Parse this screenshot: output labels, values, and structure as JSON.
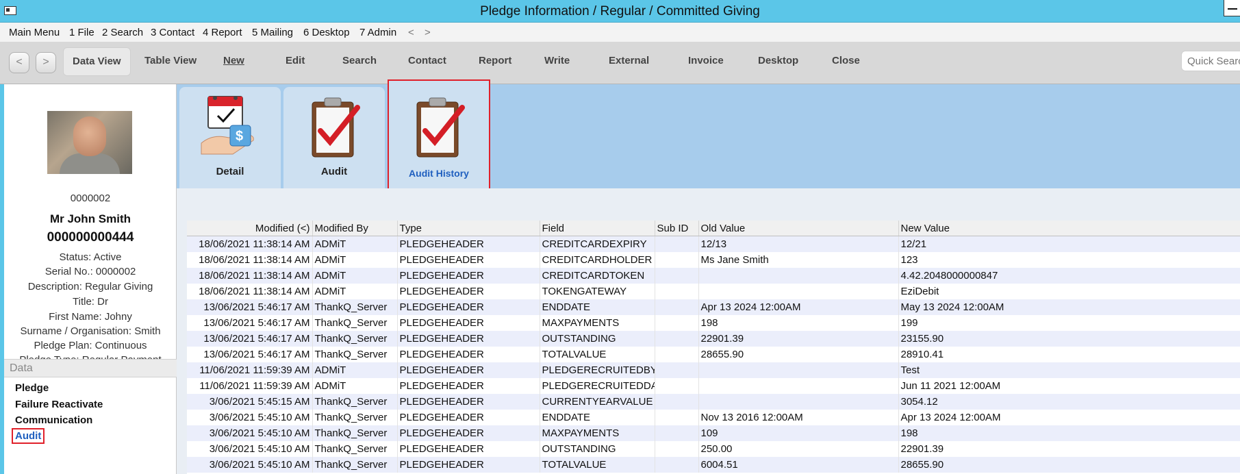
{
  "window": {
    "title": "Pledge Information / Regular / Committed Giving"
  },
  "menu": {
    "items": [
      "Main Menu",
      "1 File",
      "2 Search",
      "3 Contact",
      "4 Report",
      "5 Mailing",
      "6 Desktop",
      "7 Admin"
    ],
    "back": "<",
    "forward": ">"
  },
  "toolbar": {
    "back_label": "<",
    "forward_label": ">",
    "items": [
      "Data View",
      "Table View",
      "New",
      "Edit",
      "Search",
      "Contact",
      "Report",
      "Write",
      "External",
      "Invoice",
      "Desktop",
      "Close"
    ],
    "quick_search_placeholder": "Quick Search"
  },
  "profile": {
    "id": "0000002",
    "name": "Mr John Smith",
    "pledge_number": "000000000444",
    "status": "Status: Active",
    "serial": "Serial No.: 0000002",
    "description": "Description: Regular Giving",
    "title": "Title: Dr",
    "first_name": "First Name: Johny",
    "surname": "Surname / Organisation: Smith",
    "pledge_plan": "Pledge Plan: Continuous",
    "pledge_type": "Pledge Type: Regular Payment"
  },
  "data_section": {
    "header": "Data",
    "items": [
      "Pledge",
      "Failure Reactivate",
      "Communication",
      "Audit"
    ],
    "selected": "Audit"
  },
  "tabs": [
    {
      "label": "Detail",
      "icon": "calendar-money-icon"
    },
    {
      "label": "Audit",
      "icon": "clipboard-check-icon"
    },
    {
      "label": "Audit History",
      "icon": "clipboard-check-icon"
    }
  ],
  "grid": {
    "columns": [
      "Modified (<)",
      "Modified By",
      "Type",
      "Field",
      "Sub ID",
      "Old Value",
      "New Value"
    ],
    "rows": [
      [
        "18/06/2021 11:38:14 AM",
        "ADMiT",
        "PLEDGEHEADER",
        "CREDITCARDEXPIRY",
        "",
        "12/13",
        "12/21"
      ],
      [
        "18/06/2021 11:38:14 AM",
        "ADMiT",
        "PLEDGEHEADER",
        "CREDITCARDHOLDER",
        "",
        "Ms Jane Smith",
        "123"
      ],
      [
        "18/06/2021 11:38:14 AM",
        "ADMiT",
        "PLEDGEHEADER",
        "CREDITCARDTOKEN",
        "",
        "",
        "4.42.2048000000847"
      ],
      [
        "18/06/2021 11:38:14 AM",
        "ADMiT",
        "PLEDGEHEADER",
        "TOKENGATEWAY",
        "",
        "",
        "EziDebit"
      ],
      [
        "13/06/2021 5:46:17 AM",
        "ThankQ_Server",
        "PLEDGEHEADER",
        "ENDDATE",
        "",
        "Apr 13 2024 12:00AM",
        "May 13 2024 12:00AM"
      ],
      [
        "13/06/2021 5:46:17 AM",
        "ThankQ_Server",
        "PLEDGEHEADER",
        "MAXPAYMENTS",
        "",
        "198",
        "199"
      ],
      [
        "13/06/2021 5:46:17 AM",
        "ThankQ_Server",
        "PLEDGEHEADER",
        "OUTSTANDING",
        "",
        "22901.39",
        "23155.90"
      ],
      [
        "13/06/2021 5:46:17 AM",
        "ThankQ_Server",
        "PLEDGEHEADER",
        "TOTALVALUE",
        "",
        "28655.90",
        "28910.41"
      ],
      [
        "11/06/2021 11:59:39 AM",
        "ADMiT",
        "PLEDGEHEADER",
        "PLEDGERECRUITEDBY",
        "",
        "",
        "Test"
      ],
      [
        "11/06/2021 11:59:39 AM",
        "ADMiT",
        "PLEDGEHEADER",
        "PLEDGERECRUITEDDATE",
        "",
        "",
        "Jun 11 2021 12:00AM"
      ],
      [
        "3/06/2021 5:45:15 AM",
        "ThankQ_Server",
        "PLEDGEHEADER",
        "CURRENTYEARVALUE",
        "",
        "",
        "3054.12"
      ],
      [
        "3/06/2021 5:45:10 AM",
        "ThankQ_Server",
        "PLEDGEHEADER",
        "ENDDATE",
        "",
        "Nov 13 2016 12:00AM",
        "Apr 13 2024 12:00AM"
      ],
      [
        "3/06/2021 5:45:10 AM",
        "ThankQ_Server",
        "PLEDGEHEADER",
        "MAXPAYMENTS",
        "",
        "109",
        "198"
      ],
      [
        "3/06/2021 5:45:10 AM",
        "ThankQ_Server",
        "PLEDGEHEADER",
        "OUTSTANDING",
        "",
        "250.00",
        "22901.39"
      ],
      [
        "3/06/2021 5:45:10 AM",
        "ThankQ_Server",
        "PLEDGEHEADER",
        "TOTALVALUE",
        "",
        "6004.51",
        "28655.90"
      ]
    ]
  },
  "colors": {
    "titlebar": "#5bc6e8",
    "tab_area": "#a7ccec",
    "highlight": "#e0202a",
    "selected_text": "#1f5fbf"
  }
}
